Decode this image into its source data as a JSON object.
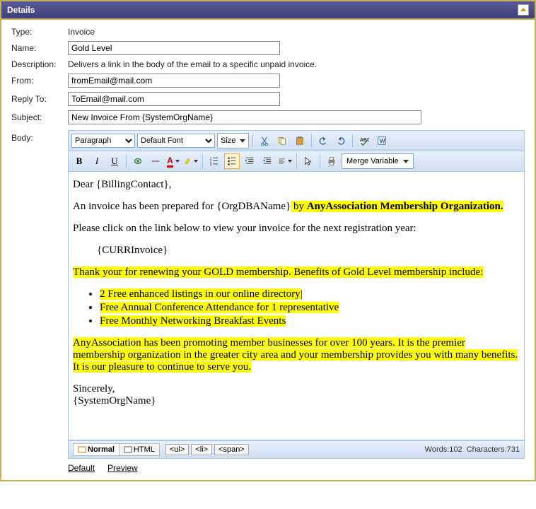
{
  "header": {
    "title": "Details"
  },
  "form": {
    "type_label": "Type:",
    "type_value": "Invoice",
    "name_label": "Name:",
    "name_value": "Gold Level",
    "description_label": "Description:",
    "description_value": "Delivers a link in the body of the email to a specific unpaid invoice.",
    "from_label": "From:",
    "from_value": "fromEmail@mail.com",
    "replyto_label": "Reply To:",
    "replyto_value": "ToEmail@mail.com",
    "subject_label": "Subject:",
    "subject_value": "New Invoice From {SystemOrgName}",
    "body_label": "Body:"
  },
  "editor": {
    "paragraph_select": "Paragraph",
    "font_select": "Default Font",
    "size_label": "Size",
    "merge_label": "Merge Variable",
    "view_normal": "Normal",
    "view_html": "HTML",
    "crumb_ul": "<ul>",
    "crumb_li": "<li>",
    "crumb_span": "<span>",
    "words_label": "Words:",
    "words_value": "102",
    "chars_label": "Characters:",
    "chars_value": "731"
  },
  "body_content": {
    "p1": "Dear {BillingContact},",
    "p2a": "An invoice has been prepared for {OrgDBAName}",
    "p2b_hl": " by ",
    "p2c_hl_bold": "AnyAssociation Membership Organization.",
    "p3": "Please click on the link below to view your invoice for the next registration year:",
    "p4": "{CURRInvoice}",
    "p5_hl": "Thank your for renewing your GOLD membership.  Benefits of Gold Level membership include:",
    "li1_hl": " 2 Free enhanced listings in our online directory",
    "li2_hl": "Free Annual Conference Attendance for 1 representative",
    "li3_hl": "Free Monthly Networking Breakfast Events",
    "p6_hl": "AnyAssociation has been promoting member businesses for over 100 years.  It is the premier membership organization in the greater city area and your membership provides you with many benefits.  It is our pleasure to continue to serve you.",
    "p7": "Sincerely,",
    "p8": "{SystemOrgName}"
  },
  "bottom_links": {
    "default": "Default",
    "preview": "Preview"
  }
}
